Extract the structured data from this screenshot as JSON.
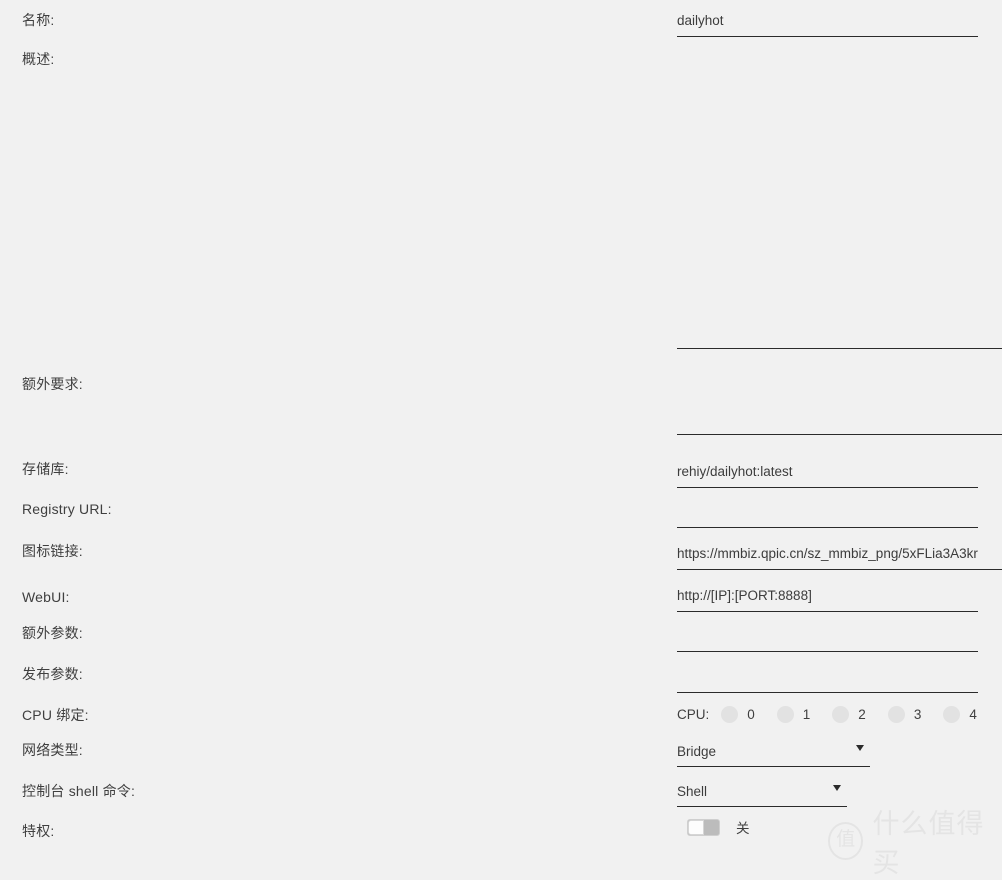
{
  "form": {
    "fields": [
      {
        "key": "name",
        "label": "名称:",
        "type": "text",
        "value": "dailyhot",
        "placeholder": ""
      },
      {
        "key": "description",
        "label": "概述:",
        "type": "textarea",
        "value": "",
        "placeholder": ""
      },
      {
        "key": "extra_requirements",
        "label": "额外要求:",
        "type": "textarea",
        "value": "",
        "placeholder": ""
      },
      {
        "key": "repository",
        "label": "存储库:",
        "type": "text",
        "value": "rehiy/dailyhot:latest",
        "placeholder": ""
      },
      {
        "key": "registry_url",
        "label": "Registry URL:",
        "type": "text",
        "value": "",
        "placeholder": ""
      },
      {
        "key": "icon_url",
        "label": "图标链接:",
        "type": "text",
        "value": "https://mmbiz.qpic.cn/sz_mmbiz_png/5xFLia3A3kr",
        "placeholder": ""
      },
      {
        "key": "webui",
        "label": "WebUI:",
        "type": "text",
        "value": "http://[IP]:[PORT:8888]",
        "placeholder": ""
      },
      {
        "key": "extra_parameters",
        "label": "额外参数:",
        "type": "text",
        "value": "",
        "placeholder": ""
      },
      {
        "key": "publish_parameters",
        "label": "发布参数:",
        "type": "text",
        "value": "",
        "placeholder": ""
      },
      {
        "key": "cpu_binding",
        "label": "CPU 绑定:",
        "type": "radio-group"
      },
      {
        "key": "network_type",
        "label": "网络类型:",
        "type": "select"
      },
      {
        "key": "console_shell",
        "label": "控制台 shell 命令:",
        "type": "select"
      },
      {
        "key": "privileged",
        "label": "特权:",
        "type": "toggle"
      }
    ],
    "cpu_binding": {
      "title": "CPU:",
      "options": [
        {
          "num": "0",
          "checked": false
        },
        {
          "num": "1",
          "checked": false
        },
        {
          "num": "2",
          "checked": false
        },
        {
          "num": "3",
          "checked": false
        },
        {
          "num": "4",
          "checked": false
        }
      ]
    },
    "network_type": {
      "selected": "Bridge",
      "options": [
        "Bridge"
      ]
    },
    "console_shell": {
      "selected": "Shell",
      "options": [
        "Shell"
      ]
    },
    "privileged": {
      "state_label": "关",
      "on": false
    }
  },
  "watermark": {
    "badge": "值",
    "text": "什么值得买"
  },
  "colors": {
    "background": "#f1f1f1",
    "text": "#3c3c3c",
    "underline": "#2b2b2b",
    "radio": "#e2e2e2"
  }
}
